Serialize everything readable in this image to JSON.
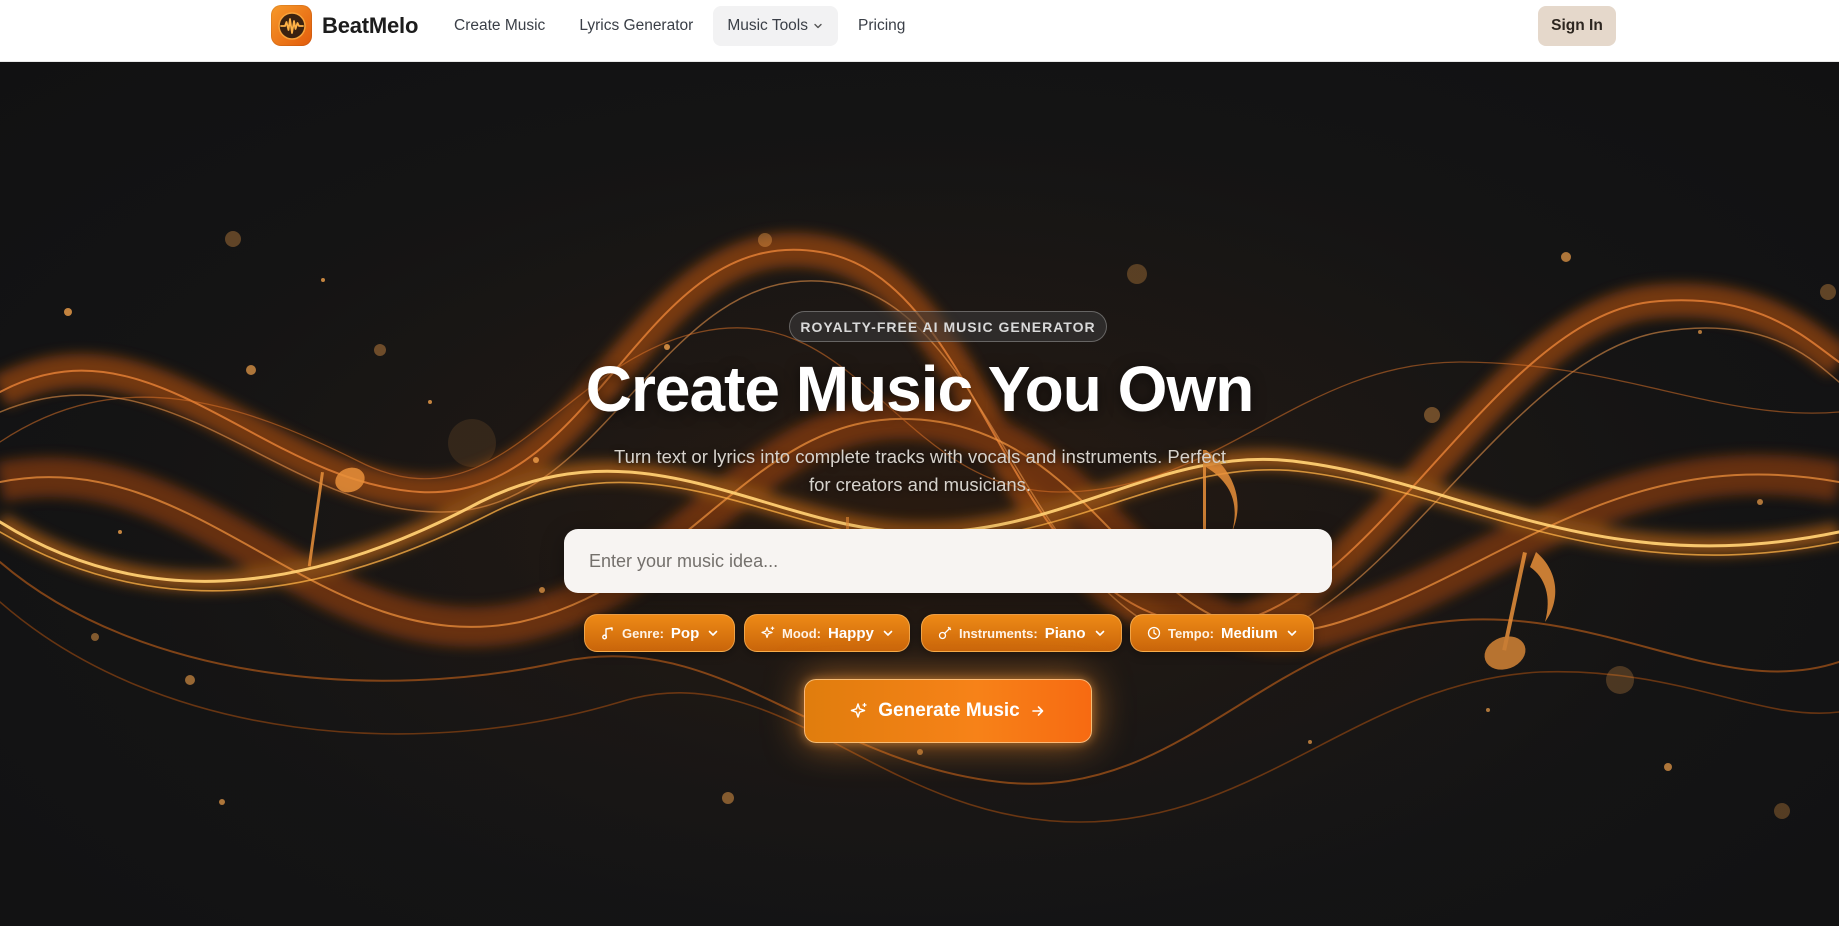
{
  "brand": {
    "name": "BeatMelo",
    "logo_icon": "waveform-logo-icon",
    "accent": "#f08515"
  },
  "nav": {
    "items": [
      {
        "label": "Create Music"
      },
      {
        "label": "Lyrics Generator"
      },
      {
        "label": "Music Tools",
        "has_dropdown": true,
        "active": true
      },
      {
        "label": "Pricing"
      }
    ]
  },
  "auth": {
    "signin_label": "Sign In"
  },
  "hero": {
    "badge": "ROYALTY-FREE AI MUSIC GENERATOR",
    "title": "Create Music You Own",
    "subtitle": "Turn text or lyrics into complete tracks with vocals and instruments. Perfect for creators and musicians.",
    "prompt_placeholder": "Enter your music idea...",
    "prompt_value": "",
    "options": [
      {
        "label": "Genre:",
        "value": "Pop",
        "icon": "music-note-icon"
      },
      {
        "label": "Mood:",
        "value": "Happy",
        "icon": "sparkle-icon"
      },
      {
        "label": "Instruments:",
        "value": "Piano",
        "icon": "guitar-icon"
      },
      {
        "label": "Tempo:",
        "value": "Medium",
        "icon": "clock-icon"
      }
    ],
    "generate_label": "Generate Music"
  }
}
